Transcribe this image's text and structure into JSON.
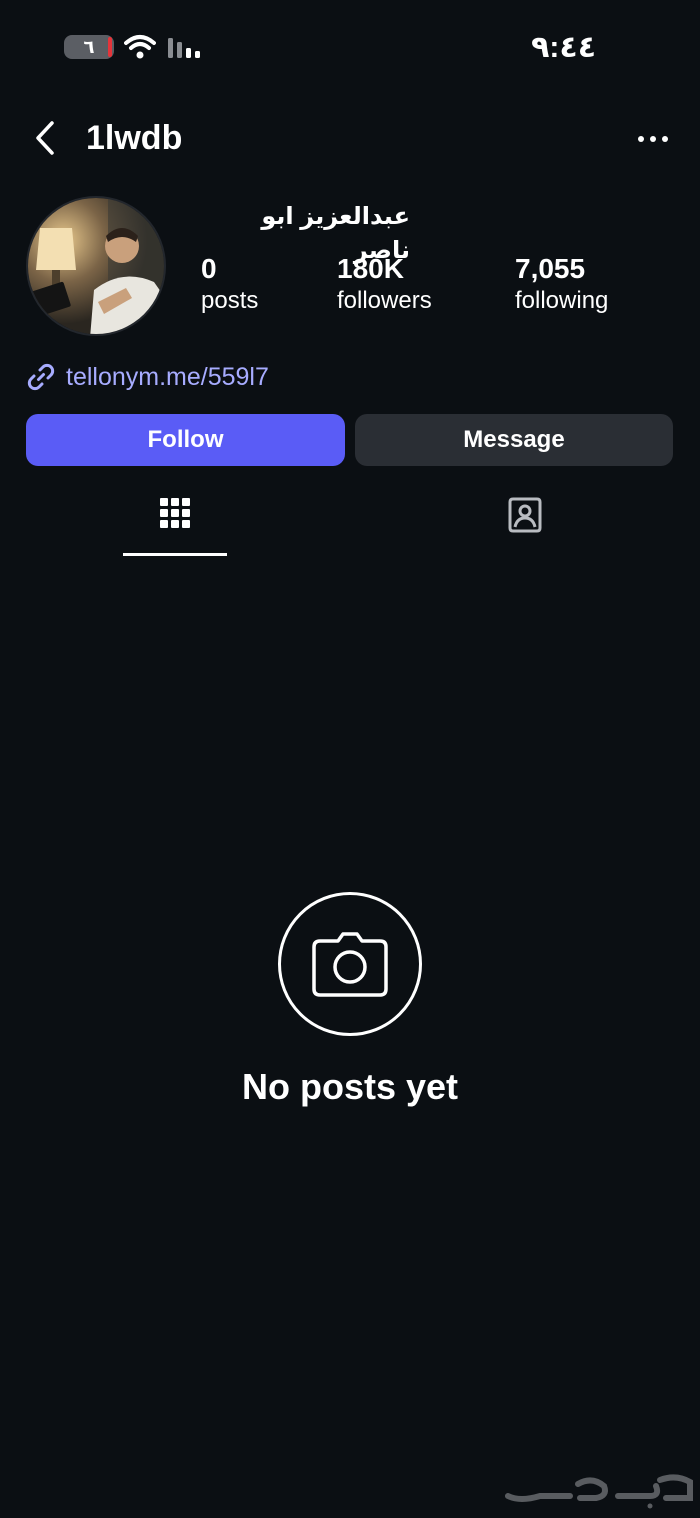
{
  "status_bar": {
    "battery_level": "٦",
    "time": "٩:٤٤",
    "icons": [
      "battery-icon",
      "wifi-icon",
      "signal-icon"
    ]
  },
  "header": {
    "username": "1lwdb",
    "icons": [
      "back-arrow-icon",
      "more-options-icon"
    ]
  },
  "profile": {
    "full_name": "عبدالعزيز ابو ناصر",
    "stats": {
      "posts": {
        "value": "0",
        "label": "posts"
      },
      "followers": {
        "value": "180K",
        "label": "followers"
      },
      "following": {
        "value": "7,055",
        "label": "following"
      }
    },
    "link": "tellonym.me/559l7",
    "link_icon": "link-icon"
  },
  "actions": {
    "follow": "Follow",
    "message": "Message"
  },
  "tabs": [
    {
      "icon": "grid-icon",
      "active": true
    },
    {
      "icon": "tagged-person-icon",
      "active": false
    }
  ],
  "empty_state": {
    "icon": "camera-icon",
    "text": "No posts yet"
  },
  "colors": {
    "background": "#0b0f13",
    "follow_button": "#5a5cf6",
    "message_button": "#2a2e34",
    "link": "#a7acff"
  }
}
